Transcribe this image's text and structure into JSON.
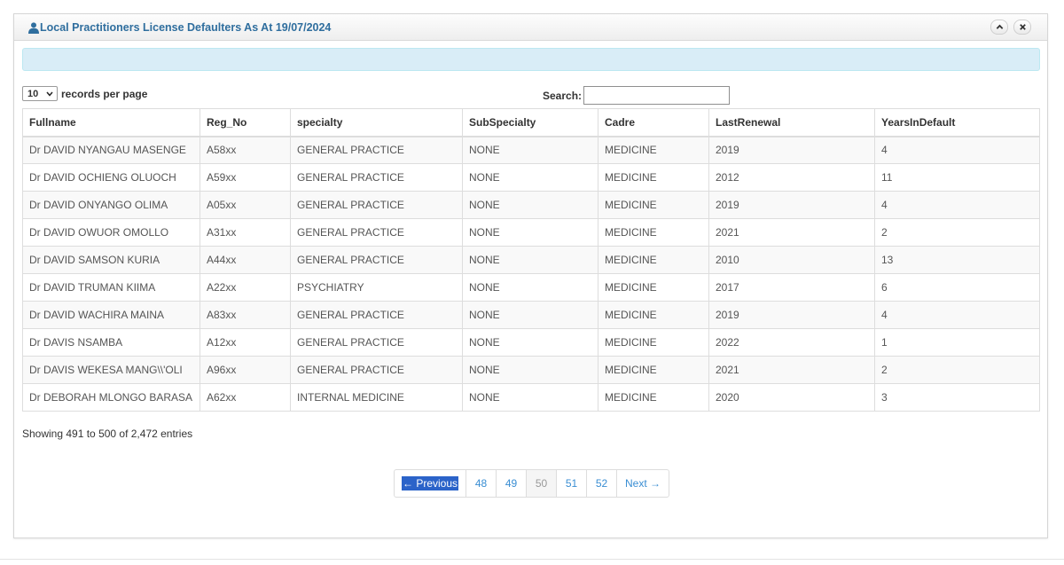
{
  "widget": {
    "title": "Local Practitioners License Defaulters As At 19/07/2024",
    "title_color": "#2f6e9e"
  },
  "length_control": {
    "selected": "10",
    "label": "records per page"
  },
  "search": {
    "label": "Search:",
    "value": ""
  },
  "table": {
    "columns": [
      "Fullname",
      "Reg_No",
      "specialty",
      "SubSpecialty",
      "Cadre",
      "LastRenewal",
      "YearsInDefault"
    ],
    "rows": [
      [
        "Dr DAVID NYANGAU MASENGE",
        "A58xx",
        "GENERAL PRACTICE",
        "NONE",
        "MEDICINE",
        "2019",
        "4"
      ],
      [
        "Dr DAVID OCHIENG OLUOCH",
        "A59xx",
        "GENERAL PRACTICE",
        "NONE",
        "MEDICINE",
        "2012",
        "11"
      ],
      [
        "Dr DAVID ONYANGO OLIMA",
        "A05xx",
        "GENERAL PRACTICE",
        "NONE",
        "MEDICINE",
        "2019",
        "4"
      ],
      [
        "Dr DAVID OWUOR OMOLLO",
        "A31xx",
        "GENERAL PRACTICE",
        "NONE",
        "MEDICINE",
        "2021",
        "2"
      ],
      [
        "Dr DAVID SAMSON KURIA",
        "A44xx",
        "GENERAL PRACTICE",
        "NONE",
        "MEDICINE",
        "2010",
        "13"
      ],
      [
        "Dr DAVID TRUMAN KIIMA",
        "A22xx",
        "PSYCHIATRY",
        "NONE",
        "MEDICINE",
        "2017",
        "6"
      ],
      [
        "Dr DAVID WACHIRA MAINA",
        "A83xx",
        "GENERAL PRACTICE",
        "NONE",
        "MEDICINE",
        "2019",
        "4"
      ],
      [
        "Dr DAVIS NSAMBA",
        "A12xx",
        "GENERAL PRACTICE",
        "NONE",
        "MEDICINE",
        "2022",
        "1"
      ],
      [
        "Dr DAVIS WEKESA MANG\\\\'OLI",
        "A96xx",
        "GENERAL PRACTICE",
        "NONE",
        "MEDICINE",
        "2021",
        "2"
      ],
      [
        "Dr DEBORAH MLONGO BARASA",
        "A62xx",
        "INTERNAL MEDICINE",
        "NONE",
        "MEDICINE",
        "2020",
        "3"
      ]
    ]
  },
  "info": "Showing 491 to 500 of 2,472 entries",
  "pagination": {
    "previous": "← Previous",
    "pages": [
      "48",
      "49",
      "50",
      "51",
      "52"
    ],
    "active_page": "50",
    "next": "Next →"
  },
  "icons": {
    "title": "user-icon",
    "collapse": "chevron-up-icon",
    "close": "close-icon",
    "select": "chevron-down-icon"
  },
  "colors": {
    "alert_background": "#d9edf7",
    "link": "#3a8ed3",
    "selection": "#2b63c9"
  }
}
